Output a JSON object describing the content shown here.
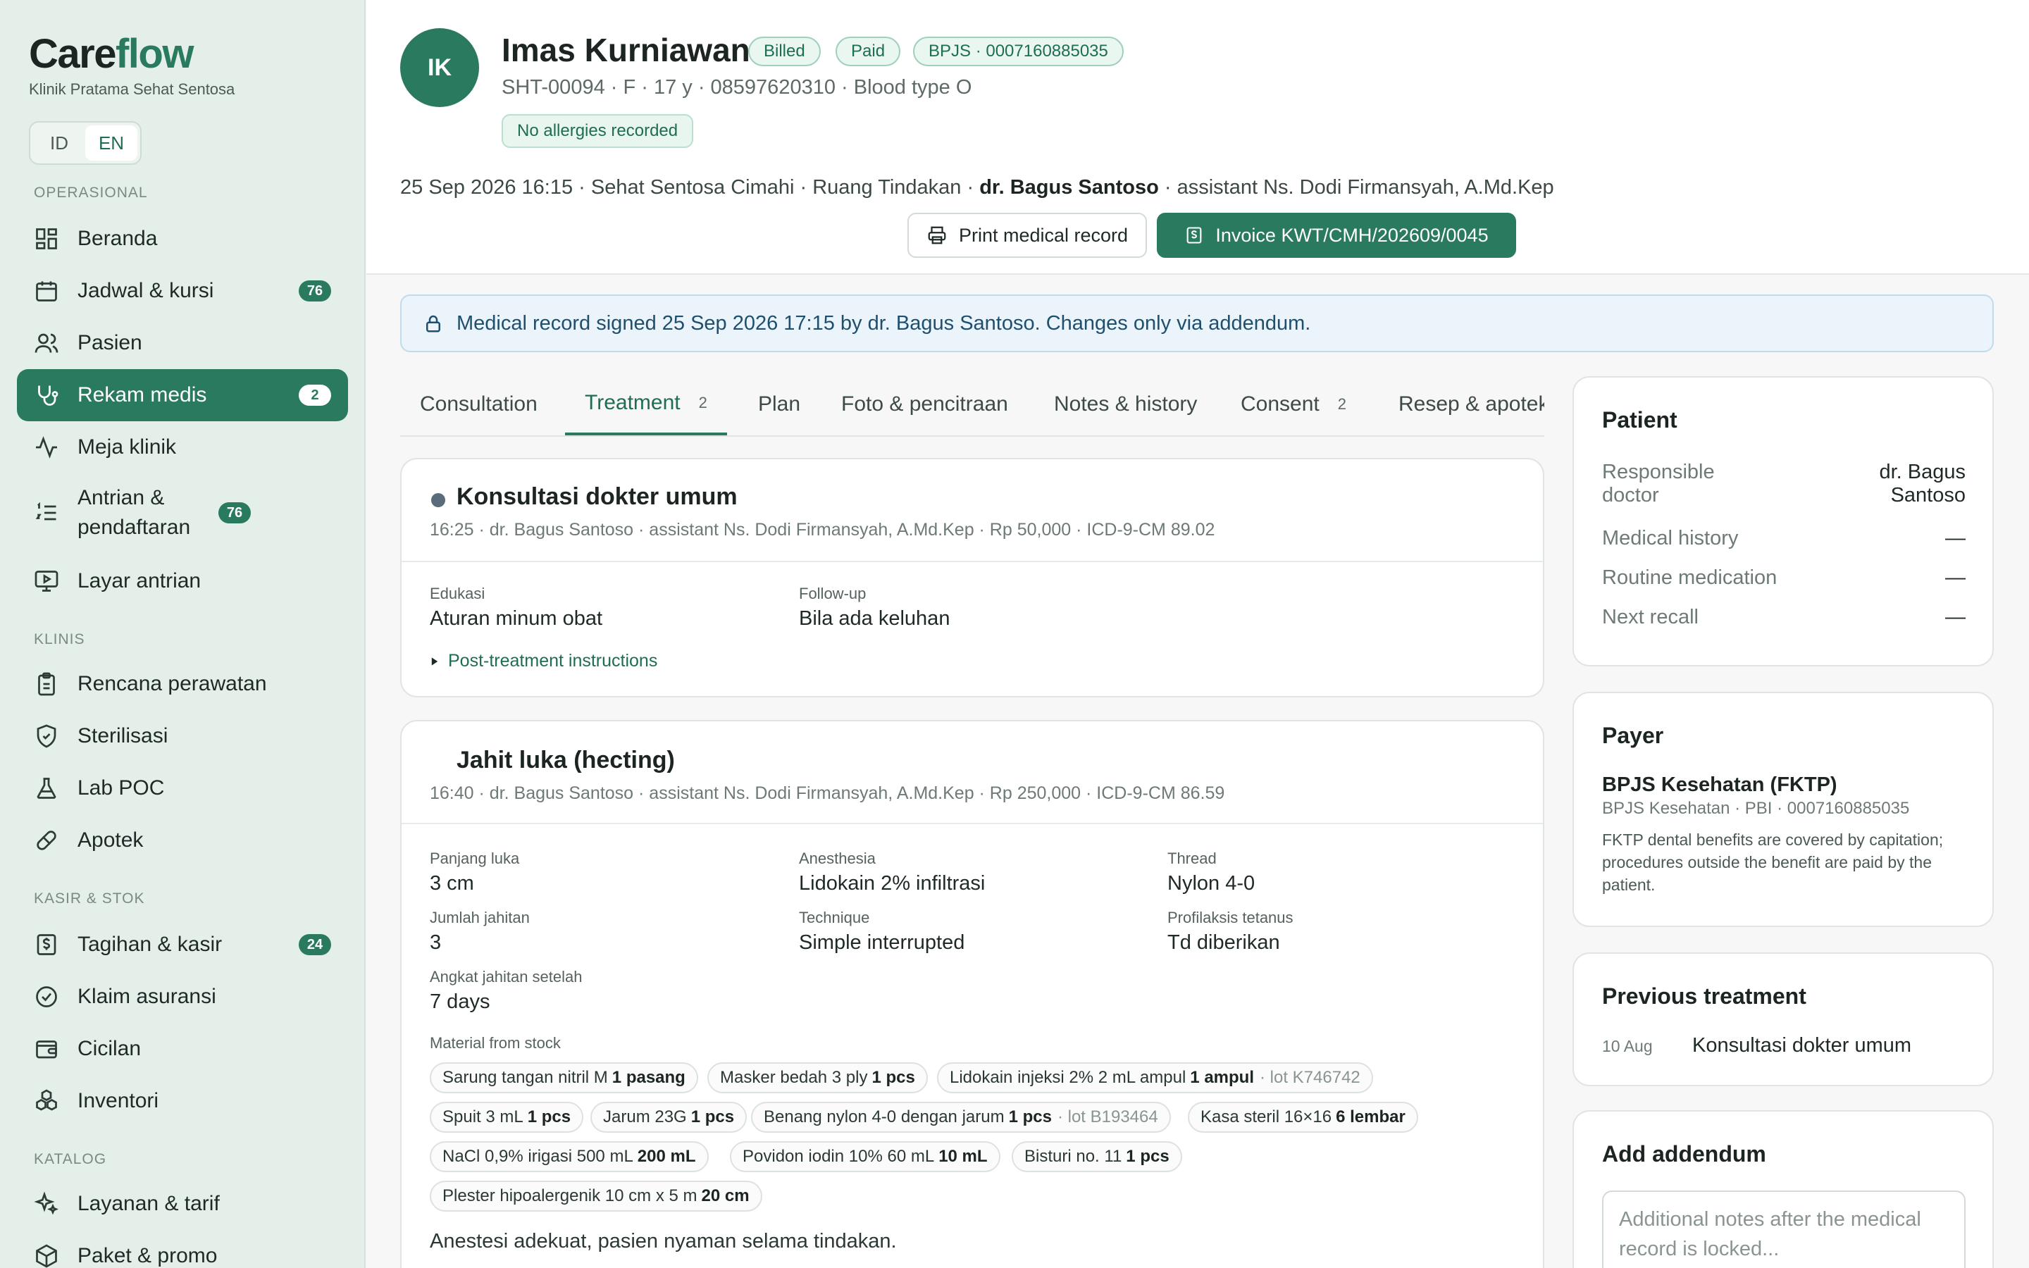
{
  "brand": {
    "name_part1": "Care",
    "name_part2": "flow",
    "clinic": "Klinik Pratama Sehat Sentosa",
    "accent_color": "#2a7a5f"
  },
  "language": {
    "options": [
      "ID",
      "EN"
    ],
    "selected": "EN"
  },
  "sidebar": {
    "sections": [
      {
        "title": "OPERASIONAL",
        "items": [
          {
            "label": "Beranda",
            "icon": "dashboard-icon"
          },
          {
            "label": "Jadwal & kursi",
            "icon": "calendar-icon",
            "badge": "76"
          },
          {
            "label": "Pasien",
            "icon": "users-icon"
          },
          {
            "label": "Rekam medis",
            "icon": "stethoscope-icon",
            "badge": "2",
            "active": true
          },
          {
            "label": "Meja klinik",
            "icon": "activity-icon"
          },
          {
            "label": "Antrian & pendaftaran",
            "icon": "list-ordered-icon",
            "badge": "76"
          },
          {
            "label": "Layar antrian",
            "icon": "monitor-play-icon"
          }
        ]
      },
      {
        "title": "KLINIS",
        "items": [
          {
            "label": "Rencana perawatan",
            "icon": "clipboard-icon"
          },
          {
            "label": "Sterilisasi",
            "icon": "shield-check-icon"
          },
          {
            "label": "Lab POC",
            "icon": "flask-icon"
          },
          {
            "label": "Apotek",
            "icon": "pill-icon"
          }
        ]
      },
      {
        "title": "KASIR & STOK",
        "items": [
          {
            "label": "Tagihan & kasir",
            "icon": "receipt-dollar-icon",
            "badge": "24"
          },
          {
            "label": "Klaim asuransi",
            "icon": "check-circle-icon"
          },
          {
            "label": "Cicilan",
            "icon": "wallet-icon"
          },
          {
            "label": "Inventori",
            "icon": "boxes-icon"
          }
        ]
      },
      {
        "title": "KATALOG",
        "items": [
          {
            "label": "Layanan & tarif",
            "icon": "sparkles-icon"
          },
          {
            "label": "Paket & promo",
            "icon": "package-icon"
          }
        ]
      }
    ]
  },
  "patient": {
    "initials": "IK",
    "name": "Imas Kurniawan",
    "status_billed": "Billed",
    "status_paid": "Paid",
    "bpjs": "BPJS · 0007160885035",
    "meta": "SHT-00094 · F · 17 y · 08597620310 · Blood type O",
    "allergies": "No allergies recorded"
  },
  "visit": {
    "prefix": "25 Sep 2026 16:15 · Sehat Sentosa Cimahi · Ruang Tindakan · ",
    "doctor": "dr. Bagus Santoso",
    "suffix": " · assistant Ns. Dodi Firmansyah, A.Md.Kep"
  },
  "actions": {
    "print": "Print medical record",
    "invoice": "Invoice KWT/CMH/202609/0045"
  },
  "locked_banner": "Medical record signed 25 Sep 2026 17:15 by dr. Bagus Santoso. Changes only via addendum.",
  "tabs": [
    {
      "label": "Consultation"
    },
    {
      "label": "Treatment",
      "count": "2",
      "active": true
    },
    {
      "label": "Plan"
    },
    {
      "label": "Foto & pencitraan"
    },
    {
      "label": "Notes & history"
    },
    {
      "label": "Consent",
      "count": "2"
    },
    {
      "label": "Resep & apotek"
    }
  ],
  "procedures": [
    {
      "title": "Konsultasi dokter umum",
      "meta": "16:25 · dr. Bagus Santoso · assistant Ns. Dodi Firmansyah, A.Md.Kep · Rp 50,000 · ICD-9-CM 89.02",
      "fields": [
        {
          "label": "Edukasi",
          "value": "Aturan minum obat"
        },
        {
          "label": "Follow-up",
          "value": "Bila ada keluhan"
        }
      ],
      "disclosure": "Post-treatment instructions"
    },
    {
      "title": "Jahit luka (hecting)",
      "meta": "16:40 · dr. Bagus Santoso · assistant Ns. Dodi Firmansyah, A.Md.Kep · Rp 250,000 · ICD-9-CM 86.59",
      "fields": [
        {
          "label": "Panjang luka",
          "value": "3 cm"
        },
        {
          "label": "Anesthesia",
          "value": "Lidokain 2% infiltrasi"
        },
        {
          "label": "Thread",
          "value": "Nylon 4-0"
        },
        {
          "label": "Jumlah jahitan",
          "value": "3"
        },
        {
          "label": "Technique",
          "value": "Simple interrupted"
        },
        {
          "label": "Profilaksis tetanus",
          "value": "Td diberikan"
        },
        {
          "label": "Angkat jahitan setelah",
          "value": "7 days"
        }
      ],
      "materials_label": "Material from stock",
      "materials": [
        {
          "name": "Sarung tangan nitril M",
          "qty": "1 pasang"
        },
        {
          "name": "Masker bedah 3 ply",
          "qty": "1 pcs"
        },
        {
          "name": "Lidokain injeksi 2% 2 mL ampul",
          "qty": "1 ampul",
          "lot": "· lot K746742"
        },
        {
          "name": "Spuit 3 mL",
          "qty": "1 pcs"
        },
        {
          "name": "Jarum 23G",
          "qty": "1 pcs"
        },
        {
          "name": "Benang nylon 4-0 dengan jarum",
          "qty": "1 pcs",
          "lot": "· lot B193464"
        },
        {
          "name": "Kasa steril 16×16",
          "qty": "6 lembar"
        },
        {
          "name": "NaCl 0,9% irigasi 500 mL",
          "qty": "200 mL"
        },
        {
          "name": "Povidon iodin 10% 60 mL",
          "qty": "10 mL"
        },
        {
          "name": "Bisturi no. 11",
          "qty": "1 pcs"
        },
        {
          "name": "Plester hipoalergenik 10 cm x 5 m",
          "qty": "20 cm"
        }
      ],
      "note": "Anestesi adekuat, pasien nyaman selama tindakan."
    }
  ],
  "patient_panel": {
    "title": "Patient",
    "responsible_label_1": "Responsible",
    "responsible_label_2": "doctor",
    "responsible_value_1": "dr. Bagus",
    "responsible_value_2": "Santoso",
    "rows": [
      {
        "label": "Medical history",
        "value": "—"
      },
      {
        "label": "Routine medication",
        "value": "—"
      },
      {
        "label": "Next recall",
        "value": "—"
      }
    ]
  },
  "payer_panel": {
    "title": "Payer",
    "name": "BPJS Kesehatan (FKTP)",
    "sub": "BPJS Kesehatan · PBI · 0007160885035",
    "note": "FKTP dental benefits are covered by capitation; procedures outside the benefit are paid by the patient."
  },
  "previous_panel": {
    "title": "Previous treatment",
    "date": "10 Aug",
    "name": "Konsultasi dokter umum"
  },
  "addendum_panel": {
    "title": "Add addendum",
    "placeholder": "Additional notes after the medical record is locked..."
  }
}
